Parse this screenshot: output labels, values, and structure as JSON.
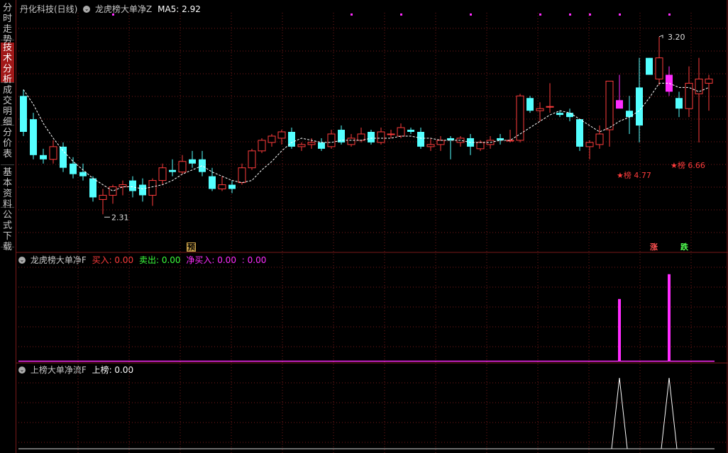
{
  "sidebar": {
    "tabs": [
      {
        "label": "分时走势",
        "active": false
      },
      {
        "label": "技术分析",
        "active": true
      },
      {
        "label": "成交明细",
        "active": false
      },
      {
        "label": "分价表",
        "active": false
      },
      {
        "label": "基本资料",
        "active": false
      },
      {
        "label": "公式下载",
        "active": false
      }
    ]
  },
  "main_panel": {
    "stock_title": "丹化科技(日线)",
    "indicator_name": "龙虎榜大单净Z",
    "ma_label": "MA5: 2.92",
    "high_label": "3.20",
    "low_label": "2.31",
    "marker1": "★榜 4.77",
    "marker2": "★榜 6.66",
    "badge_yu": "预",
    "badge_zhang": "涨",
    "badge_die": "跌"
  },
  "panel2": {
    "name": "龙虎榜大单净F",
    "buy_label": "买入: 0.00",
    "sell_label": "卖出: 0.00",
    "net_label": "净买入: 0.00",
    "extra_label": ": 0.00"
  },
  "panel3": {
    "name": "上榜大单净流F",
    "value_label": "上榜: 0.00"
  },
  "colors": {
    "up": "#ff3c3c",
    "down": "#54ffff",
    "magenta": "#ff2cff",
    "grid": "#7a1a1a",
    "ma": "#ffffff"
  },
  "chart_data": {
    "type": "candlestick",
    "ylim": [
      2.2,
      3.3
    ],
    "ohlc": [
      [
        2.92,
        2.95,
        2.73,
        2.75
      ],
      [
        2.81,
        2.84,
        2.62,
        2.64
      ],
      [
        2.64,
        2.67,
        2.6,
        2.62
      ],
      [
        2.62,
        2.71,
        2.6,
        2.68
      ],
      [
        2.68,
        2.7,
        2.56,
        2.58
      ],
      [
        2.6,
        2.63,
        2.53,
        2.55
      ],
      [
        2.56,
        2.6,
        2.52,
        2.54
      ],
      [
        2.53,
        2.54,
        2.42,
        2.44
      ],
      [
        2.43,
        2.48,
        2.36,
        2.45
      ],
      [
        2.45,
        2.5,
        2.41,
        2.49
      ],
      [
        2.49,
        2.52,
        2.45,
        2.5
      ],
      [
        2.52,
        2.54,
        2.44,
        2.47
      ],
      [
        2.5,
        2.53,
        2.42,
        2.45
      ],
      [
        2.45,
        2.53,
        2.4,
        2.52
      ],
      [
        2.52,
        2.6,
        2.5,
        2.58
      ],
      [
        2.57,
        2.62,
        2.54,
        2.56
      ],
      [
        2.56,
        2.64,
        2.55,
        2.61
      ],
      [
        2.62,
        2.66,
        2.58,
        2.6
      ],
      [
        2.62,
        2.66,
        2.54,
        2.56
      ],
      [
        2.54,
        2.58,
        2.47,
        2.48
      ],
      [
        2.48,
        2.54,
        2.47,
        2.5
      ],
      [
        2.5,
        2.52,
        2.46,
        2.48
      ],
      [
        2.51,
        2.6,
        2.5,
        2.58
      ],
      [
        2.58,
        2.67,
        2.57,
        2.66
      ],
      [
        2.66,
        2.72,
        2.65,
        2.71
      ],
      [
        2.7,
        2.74,
        2.68,
        2.73
      ],
      [
        2.72,
        2.76,
        2.69,
        2.75
      ],
      [
        2.75,
        2.77,
        2.67,
        2.68
      ],
      [
        2.68,
        2.7,
        2.66,
        2.69
      ],
      [
        2.69,
        2.72,
        2.67,
        2.7
      ],
      [
        2.7,
        2.72,
        2.66,
        2.67
      ],
      [
        2.68,
        2.76,
        2.67,
        2.74
      ],
      [
        2.76,
        2.78,
        2.69,
        2.7
      ],
      [
        2.69,
        2.74,
        2.68,
        2.72
      ],
      [
        2.71,
        2.77,
        2.7,
        2.74
      ],
      [
        2.75,
        2.76,
        2.69,
        2.7
      ],
      [
        2.7,
        2.77,
        2.69,
        2.75
      ],
      [
        2.74,
        2.76,
        2.72,
        2.74
      ],
      [
        2.73,
        2.79,
        2.72,
        2.77
      ],
      [
        2.76,
        2.77,
        2.74,
        2.75
      ],
      [
        2.75,
        2.77,
        2.67,
        2.68
      ],
      [
        2.68,
        2.72,
        2.66,
        2.69
      ],
      [
        2.69,
        2.73,
        2.66,
        2.71
      ],
      [
        2.72,
        2.73,
        2.62,
        2.71
      ],
      [
        2.7,
        2.73,
        2.68,
        2.72
      ],
      [
        2.72,
        2.74,
        2.64,
        2.68
      ],
      [
        2.67,
        2.71,
        2.66,
        2.7
      ],
      [
        2.69,
        2.73,
        2.67,
        2.71
      ],
      [
        2.72,
        2.74,
        2.69,
        2.71
      ],
      [
        2.71,
        2.76,
        2.7,
        2.71
      ],
      [
        2.71,
        2.93,
        2.7,
        2.92
      ],
      [
        2.91,
        2.92,
        2.84,
        2.85
      ],
      [
        2.85,
        2.89,
        2.8,
        2.86
      ],
      [
        2.87,
        2.98,
        2.84,
        2.87
      ],
      [
        2.84,
        2.85,
        2.82,
        2.83
      ],
      [
        2.84,
        2.86,
        2.8,
        2.82
      ],
      [
        2.81,
        2.81,
        2.66,
        2.68
      ],
      [
        2.68,
        2.71,
        2.62,
        2.7
      ],
      [
        2.69,
        2.78,
        2.67,
        2.74
      ],
      [
        2.76,
        2.99,
        2.68,
        2.99
      ],
      [
        2.9,
        3.02,
        2.87,
        2.86
      ],
      [
        2.85,
        2.92,
        2.74,
        2.82
      ],
      [
        2.96,
        3.1,
        2.7,
        2.78
      ],
      [
        3.1,
        3.1,
        3.02,
        3.02
      ],
      [
        3.0,
        3.2,
        2.97,
        3.1
      ],
      [
        3.02,
        3.06,
        2.92,
        2.94
      ],
      [
        2.91,
        2.94,
        2.82,
        2.86
      ],
      [
        2.86,
        3.06,
        2.82,
        2.98
      ],
      [
        2.93,
        3.1,
        2.7,
        3.0
      ],
      [
        2.98,
        3.02,
        2.85,
        3.0
      ]
    ],
    "ma5": [
      2.95,
      2.88,
      2.79,
      2.72,
      2.66,
      2.61,
      2.57,
      2.53,
      2.5,
      2.47,
      2.49,
      2.49,
      2.48,
      2.49,
      2.5,
      2.52,
      2.55,
      2.57,
      2.59,
      2.56,
      2.54,
      2.52,
      2.51,
      2.52,
      2.57,
      2.61,
      2.66,
      2.7,
      2.72,
      2.71,
      2.7,
      2.7,
      2.71,
      2.71,
      2.71,
      2.72,
      2.72,
      2.72,
      2.73,
      2.73,
      2.72,
      2.72,
      2.71,
      2.71,
      2.71,
      2.7,
      2.7,
      2.7,
      2.71,
      2.71,
      2.74,
      2.77,
      2.8,
      2.83,
      2.85,
      2.84,
      2.81,
      2.78,
      2.75,
      2.77,
      2.8,
      2.82,
      2.85,
      2.91,
      2.98,
      2.98,
      2.96,
      2.96,
      2.94,
      2.96
    ],
    "magenta_bars": [
      60,
      65
    ],
    "panel2_bars": [
      {
        "index": 60,
        "value": 4.77
      },
      {
        "index": 65,
        "value": 6.66
      }
    ],
    "panel3_spikes": [
      60,
      65
    ]
  }
}
